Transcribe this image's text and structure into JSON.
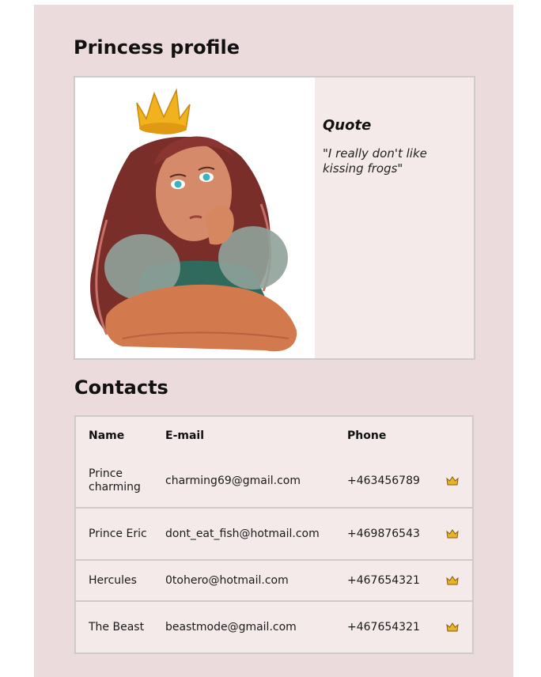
{
  "profile": {
    "title": "Princess profile",
    "quote_title": "Quote",
    "quote_text": "\"I really don't like kissing frogs\""
  },
  "contacts": {
    "title": "Contacts",
    "headers": {
      "name": "Name",
      "email": "E-mail",
      "phone": "Phone"
    },
    "rows": [
      {
        "name": "Prince charming",
        "email": "charming69@gmail.com",
        "phone": "+463456789",
        "icon": "crown-icon"
      },
      {
        "name": "Prince Eric",
        "email": "dont_eat_fish@hotmail.com",
        "phone": "+469876543",
        "icon": "crown-icon"
      },
      {
        "name": "Hercules",
        "email": "0tohero@hotmail.com",
        "phone": "+467654321",
        "icon": "crown-icon"
      },
      {
        "name": "The Beast",
        "email": "beastmode@gmail.com",
        "phone": "+467654321",
        "icon": "crown-icon"
      }
    ]
  },
  "colors": {
    "page_background": "#ecdbdc",
    "card_background": "#f4eaea",
    "border": "#d0cbcb",
    "crown_gold": "#e8b325"
  }
}
